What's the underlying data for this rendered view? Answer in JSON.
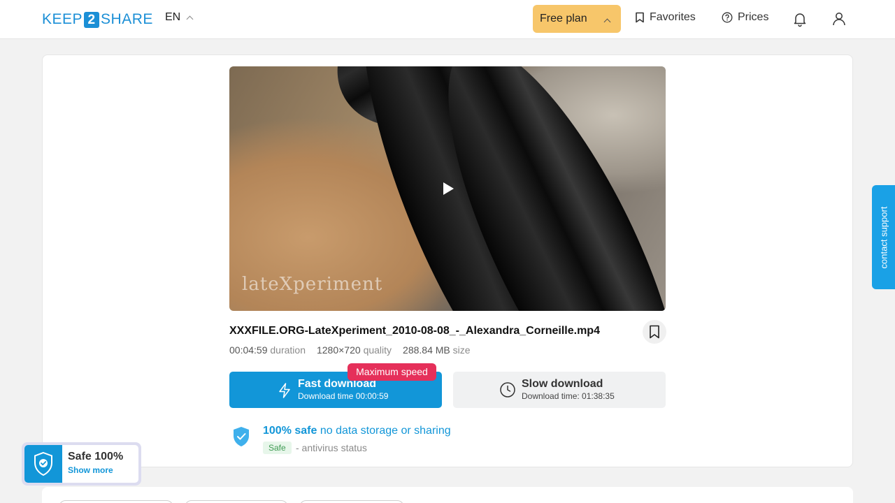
{
  "header": {
    "logo_left": "KEEP",
    "logo_num": "2",
    "logo_right": "SHARE",
    "lang": "EN",
    "plan_label": "Free plan",
    "favorites_label": "Favorites",
    "prices_label": "Prices"
  },
  "video": {
    "watermark": "lateXperiment"
  },
  "file": {
    "name": "XXXFILE.ORG-LateXperiment_2010-08-08_-_Alexandra_Corneille.mp4",
    "duration_value": "00:04:59",
    "duration_label": "duration",
    "quality_value": "1280×720",
    "quality_label": "quality",
    "size_value": "288.84 MB",
    "size_label": "size"
  },
  "download": {
    "badge": "Maximum speed",
    "fast_title": "Fast download",
    "fast_sub": "Download time 00:00:59",
    "slow_title": "Slow download",
    "slow_sub": "Download time: 01:38:35"
  },
  "safety": {
    "strong": "100% safe",
    "light": "no data storage or sharing",
    "tag": "Safe",
    "status": "- antivirus status"
  },
  "support_label": "contact support",
  "safe_widget": {
    "title": "Safe 100%",
    "link": "Show more"
  },
  "colors": {
    "accent": "#1296d8",
    "plan": "#f7c66a",
    "badge": "#e5305a"
  }
}
